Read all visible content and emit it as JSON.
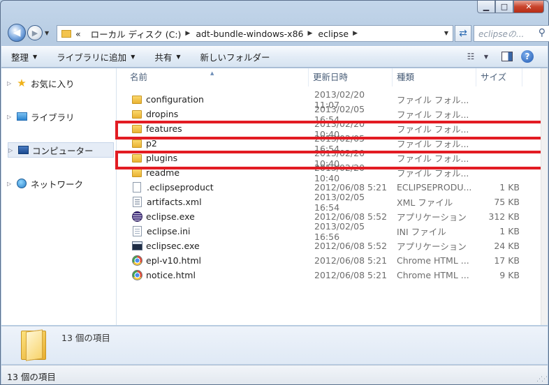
{
  "window": {
    "caption_buttons": [
      "minimize",
      "maximize",
      "close"
    ],
    "caption_glyphs": {
      "minimize": "▁",
      "maximize": "□",
      "close": "✕"
    }
  },
  "address_bar": {
    "overflow": "«",
    "crumbs": [
      "ローカル ディスク (C:)",
      "adt-bundle-windows-x86",
      "eclipse"
    ]
  },
  "search": {
    "placeholder": "eclipseの..."
  },
  "toolbar": {
    "organize": "整理",
    "add_to_library": "ライブラリに追加",
    "share": "共有",
    "new_folder": "新しいフォルダー"
  },
  "nav_pane": {
    "items": [
      {
        "label": "お気に入り",
        "icon": "star-icon"
      },
      {
        "label": "ライブラリ",
        "icon": "library-icon"
      },
      {
        "label": "コンピューター",
        "icon": "computer-icon",
        "selected": true
      },
      {
        "label": "ネットワーク",
        "icon": "network-icon"
      }
    ]
  },
  "columns": {
    "name": "名前",
    "date": "更新日時",
    "type": "種類",
    "size": "サイズ"
  },
  "files": [
    {
      "name": "configuration",
      "date": "2013/02/20 11:07",
      "type": "ファイル フォル...",
      "size": "",
      "icon": "folder"
    },
    {
      "name": "dropins",
      "date": "2013/02/05 16:54",
      "type": "ファイル フォル...",
      "size": "",
      "icon": "folder"
    },
    {
      "name": "features",
      "date": "2013/02/20 10:40",
      "type": "ファイル フォル...",
      "size": "",
      "icon": "folder",
      "highlighted": true
    },
    {
      "name": "p2",
      "date": "2013/02/05 16:54",
      "type": "ファイル フォル...",
      "size": "",
      "icon": "folder"
    },
    {
      "name": "plugins",
      "date": "2013/02/20 10:40",
      "type": "ファイル フォル...",
      "size": "",
      "icon": "folder",
      "highlighted": true
    },
    {
      "name": "readme",
      "date": "2013/02/20 10:40",
      "type": "ファイル フォル...",
      "size": "",
      "icon": "folder"
    },
    {
      "name": ".eclipseproduct",
      "date": "2012/06/08 5:21",
      "type": "ECLIPSEPRODU...",
      "size": "1 KB",
      "icon": "doc"
    },
    {
      "name": "artifacts.xml",
      "date": "2013/02/05 16:54",
      "type": "XML ファイル",
      "size": "75 KB",
      "icon": "xml"
    },
    {
      "name": "eclipse.exe",
      "date": "2012/06/08 5:52",
      "type": "アプリケーション",
      "size": "312 KB",
      "icon": "eclipse"
    },
    {
      "name": "eclipse.ini",
      "date": "2013/02/05 16:56",
      "type": "INI ファイル",
      "size": "1 KB",
      "icon": "ini"
    },
    {
      "name": "eclipsec.exe",
      "date": "2012/06/08 5:52",
      "type": "アプリケーション",
      "size": "24 KB",
      "icon": "console"
    },
    {
      "name": "epl-v10.html",
      "date": "2012/06/08 5:21",
      "type": "Chrome HTML ...",
      "size": "17 KB",
      "icon": "chrome"
    },
    {
      "name": "notice.html",
      "date": "2012/06/08 5:21",
      "type": "Chrome HTML ...",
      "size": "9 KB",
      "icon": "chrome"
    }
  ],
  "details": {
    "count_text": "13 個の項目"
  },
  "status": {
    "text": "13 個の項目"
  },
  "colors": {
    "highlight": "#e21c23",
    "folder": "#f3c44e",
    "accent": "#1f5fb3"
  }
}
